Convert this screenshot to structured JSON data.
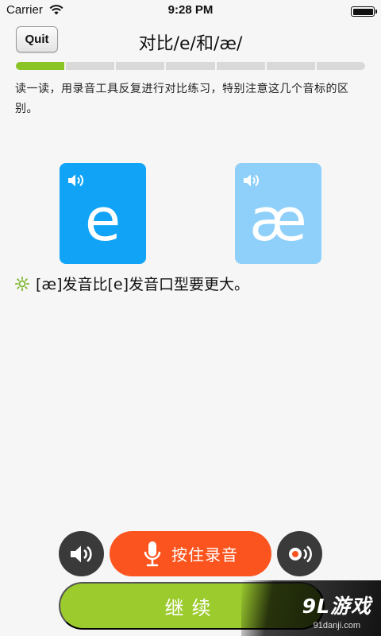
{
  "status_bar": {
    "carrier": "Carrier",
    "time": "9:28 PM"
  },
  "header": {
    "quit_label": "Quit",
    "title": "对比/e/和/æ/"
  },
  "progress": {
    "segments": 7,
    "completed": 1
  },
  "instruction": "读一读，用录音工具反复进行对比练习，特别注意这几个音标的区别。",
  "cards": [
    {
      "symbol": "e",
      "color": "#11a4f6"
    },
    {
      "symbol": "æ",
      "color": "#8fd0fa"
    }
  ],
  "tip": "[æ]发音比[e]发音口型要更大。",
  "controls": {
    "record_label": "按住录音",
    "continue_label": "继续"
  },
  "colors": {
    "progress": "#8ac426",
    "record": "#fb541e",
    "continue": "#9ccb2e",
    "dark_button": "#3a3a3a",
    "tip_icon": "#7cb428"
  },
  "watermark": {
    "logo": "9L游戏",
    "url": "91danji.com"
  }
}
